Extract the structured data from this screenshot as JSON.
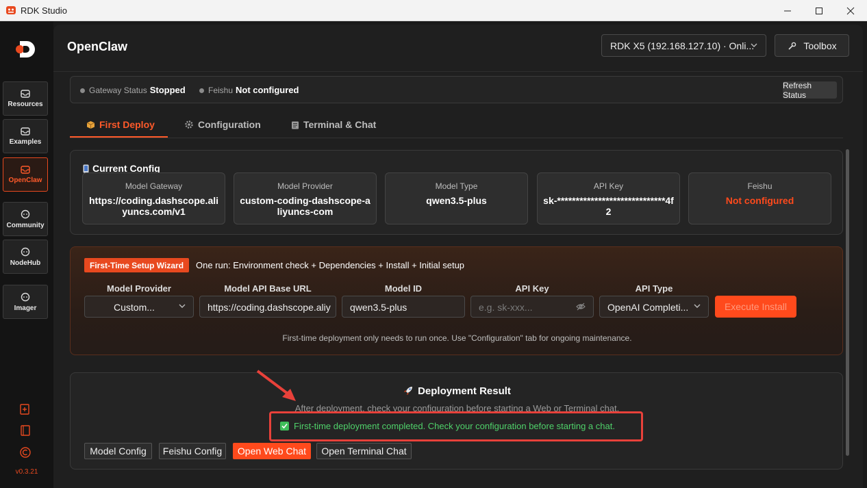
{
  "window": {
    "title": "RDK Studio"
  },
  "sidebar": {
    "items": [
      {
        "label": "Resources"
      },
      {
        "label": "Examples"
      },
      {
        "label": "OpenClaw"
      },
      {
        "label": "Community"
      },
      {
        "label": "NodeHub"
      },
      {
        "label": "Imager"
      }
    ],
    "version": "v0.3.21"
  },
  "header": {
    "title": "OpenClaw",
    "device": "RDK X5 (192.168.127.10) · Onli...",
    "toolbox": "Toolbox"
  },
  "status": {
    "gateway_label": "Gateway Status",
    "gateway_value": "Stopped",
    "feishu_label": "Feishu",
    "feishu_value": "Not configured",
    "refresh": "Refresh Status"
  },
  "tabs": [
    {
      "label": "First Deploy",
      "active": true
    },
    {
      "label": "Configuration"
    },
    {
      "label": "Terminal & Chat"
    }
  ],
  "current_config": {
    "title": "Current Config",
    "cards": [
      {
        "key": "Model Gateway",
        "value": "https://coding.dashscope.aliyuncs.com/v1"
      },
      {
        "key": "Model Provider",
        "value": "custom-coding-dashscope-aliyuncs-com"
      },
      {
        "key": "Model Type",
        "value": "qwen3.5-plus"
      },
      {
        "key": "API Key",
        "value": "sk-*****************************4f2"
      },
      {
        "key": "Feishu",
        "value": "Not configured"
      }
    ]
  },
  "wizard": {
    "badge": "First-Time Setup Wizard",
    "description": "One run: Environment check + Dependencies + Install + Initial setup",
    "fields": {
      "provider_label": "Model Provider",
      "provider_value": "Custom...",
      "base_url_label": "Model API Base URL",
      "base_url_value": "https://coding.dashscope.aliy",
      "model_id_label": "Model ID",
      "model_id_value": "qwen3.5-plus",
      "api_key_label": "API Key",
      "api_key_placeholder": "e.g. sk-xxx...",
      "api_type_label": "API Type",
      "api_type_value": "OpenAI Completi..."
    },
    "execute": "Execute Install",
    "note": "First-time deployment only needs to run once. Use \"Configuration\" tab for ongoing maintenance."
  },
  "result": {
    "title": "Deployment Result",
    "subtitle": "After deployment, check your configuration before starting a Web or Terminal chat.",
    "success": "First-time deployment completed. Check your configuration before starting a chat.",
    "buttons": {
      "model_config": "Model Config",
      "feishu_config": "Feishu Config",
      "open_web_chat": "Open Web Chat",
      "open_terminal_chat": "Open Terminal Chat"
    }
  },
  "colors": {
    "accent": "#ff4a1c",
    "success": "#4fd16a",
    "highlight_border": "#e8413a"
  }
}
